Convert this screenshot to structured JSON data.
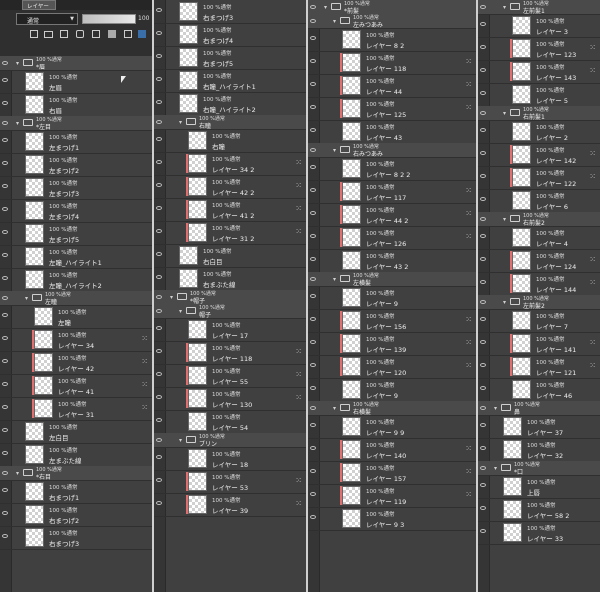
{
  "toolbar": {
    "tab_label": "レイヤー",
    "blend_mode": "通常",
    "opacity": "100",
    "icons": [
      "new-layer-icon",
      "new-folder-icon",
      "copy-layer-icon",
      "clip-icon",
      "lock-icon",
      "mask-icon",
      "delete-layer-icon"
    ]
  },
  "columns": [
    {
      "rows": [
        {
          "kind": "folder",
          "d": 0,
          "blend": "100 %通常",
          "name": "*眉"
        },
        {
          "kind": "layer",
          "d": 1,
          "blend": "100 %通常",
          "name": "左眉"
        },
        {
          "kind": "layer",
          "d": 1,
          "blend": "100 %通常",
          "name": "右眉"
        },
        {
          "kind": "folder",
          "d": 0,
          "blend": "100 %通常",
          "name": "*左目"
        },
        {
          "kind": "layer",
          "d": 1,
          "blend": "100 %通常",
          "name": "左まつげ1"
        },
        {
          "kind": "layer",
          "d": 1,
          "blend": "100 %通常",
          "name": "左まつげ2"
        },
        {
          "kind": "layer",
          "d": 1,
          "blend": "100 %通常",
          "name": "左まつげ3"
        },
        {
          "kind": "layer",
          "d": 1,
          "blend": "100 %通常",
          "name": "左まつげ4"
        },
        {
          "kind": "layer",
          "d": 1,
          "blend": "100 %通常",
          "name": "左まつげ5"
        },
        {
          "kind": "layer",
          "d": 1,
          "blend": "100 %通常",
          "name": "左瞳_ハイライト1"
        },
        {
          "kind": "layer",
          "d": 1,
          "blend": "100 %通常",
          "name": "左瞳_ハイライト2"
        },
        {
          "kind": "folder",
          "d": 1,
          "blend": "100 %通常",
          "name": "左瞳"
        },
        {
          "kind": "layer",
          "d": 2,
          "blend": "100 %通常",
          "name": "左瞳"
        },
        {
          "kind": "layer",
          "d": 2,
          "blend": "100 %通常",
          "name": "レイヤー 34",
          "clip": true
        },
        {
          "kind": "layer",
          "d": 2,
          "blend": "100 %通常",
          "name": "レイヤー 42",
          "clip": true
        },
        {
          "kind": "layer",
          "d": 2,
          "blend": "100 %通常",
          "name": "レイヤー 41",
          "clip": true
        },
        {
          "kind": "layer",
          "d": 2,
          "blend": "100 %通常",
          "name": "レイヤー 31",
          "clip": true
        },
        {
          "kind": "layer",
          "d": 1,
          "blend": "100 %通常",
          "name": "左白目"
        },
        {
          "kind": "layer",
          "d": 1,
          "blend": "100 %通常",
          "name": "左まぶた線"
        },
        {
          "kind": "folder",
          "d": 0,
          "blend": "100 %通常",
          "name": "*右目"
        },
        {
          "kind": "layer",
          "d": 1,
          "blend": "100 %通常",
          "name": "右まつげ1"
        },
        {
          "kind": "layer",
          "d": 1,
          "blend": "100 %通常",
          "name": "右まつげ2"
        },
        {
          "kind": "layer",
          "d": 1,
          "blend": "100 %通常",
          "name": "右まつげ3"
        }
      ]
    },
    {
      "rows": [
        {
          "kind": "layer",
          "d": 1,
          "blend": "100 %通常",
          "name": "右まつげ3"
        },
        {
          "kind": "layer",
          "d": 1,
          "blend": "100 %通常",
          "name": "右まつげ4"
        },
        {
          "kind": "layer",
          "d": 1,
          "blend": "100 %通常",
          "name": "右まつげ5"
        },
        {
          "kind": "layer",
          "d": 1,
          "blend": "100 %通常",
          "name": "右瞳_ハイライト1"
        },
        {
          "kind": "layer",
          "d": 1,
          "blend": "100 %通常",
          "name": "右瞳_ハイライト2"
        },
        {
          "kind": "folder",
          "d": 1,
          "blend": "100 %通常",
          "name": "右瞳"
        },
        {
          "kind": "layer",
          "d": 2,
          "blend": "100 %通常",
          "name": "右瞳"
        },
        {
          "kind": "layer",
          "d": 2,
          "blend": "100 %通常",
          "name": "レイヤー 34 2",
          "clip": true
        },
        {
          "kind": "layer",
          "d": 2,
          "blend": "100 %通常",
          "name": "レイヤー 42 2",
          "clip": true
        },
        {
          "kind": "layer",
          "d": 2,
          "blend": "100 %通常",
          "name": "レイヤー 41 2",
          "clip": true
        },
        {
          "kind": "layer",
          "d": 2,
          "blend": "100 %通常",
          "name": "レイヤー 31 2",
          "clip": true
        },
        {
          "kind": "layer",
          "d": 1,
          "blend": "100 %通常",
          "name": "右白目"
        },
        {
          "kind": "layer",
          "d": 1,
          "blend": "100 %通常",
          "name": "右まぶた線"
        },
        {
          "kind": "folder",
          "d": 0,
          "blend": "100 %通常",
          "name": "*帽子"
        },
        {
          "kind": "folder",
          "d": 1,
          "blend": "100 %通常",
          "name": "帽子"
        },
        {
          "kind": "layer",
          "d": 2,
          "blend": "100 %通常",
          "name": "レイヤー 17"
        },
        {
          "kind": "layer",
          "d": 2,
          "blend": "100 %通常",
          "name": "レイヤー 118",
          "clip": true
        },
        {
          "kind": "layer",
          "d": 2,
          "blend": "100 %通常",
          "name": "レイヤー 55",
          "clip": true
        },
        {
          "kind": "layer",
          "d": 2,
          "blend": "100 %通常",
          "name": "レイヤー 130",
          "clip": true
        },
        {
          "kind": "layer",
          "d": 2,
          "blend": "100 %通常",
          "name": "レイヤー 54"
        },
        {
          "kind": "folder",
          "d": 1,
          "blend": "100 %通常",
          "name": "ブリン"
        },
        {
          "kind": "layer",
          "d": 2,
          "blend": "100 %通常",
          "name": "レイヤー 18"
        },
        {
          "kind": "layer",
          "d": 2,
          "blend": "100 %通常",
          "name": "レイヤー 53",
          "clip": true
        },
        {
          "kind": "layer",
          "d": 2,
          "blend": "100 %通常",
          "name": "レイヤー 39",
          "clip": true
        }
      ]
    },
    {
      "rows": [
        {
          "kind": "folder",
          "d": 0,
          "blend": "100 %通常",
          "name": "*前髪"
        },
        {
          "kind": "folder",
          "d": 1,
          "blend": "100 %通常",
          "name": "左みつあみ"
        },
        {
          "kind": "layer",
          "d": 2,
          "blend": "100 %通常",
          "name": "レイヤー 8 2"
        },
        {
          "kind": "layer",
          "d": 2,
          "blend": "100 %通常",
          "name": "レイヤー 118",
          "clip": true
        },
        {
          "kind": "layer",
          "d": 2,
          "blend": "100 %通常",
          "name": "レイヤー 44",
          "clip": true
        },
        {
          "kind": "layer",
          "d": 2,
          "blend": "100 %通常",
          "name": "レイヤー 125",
          "clip": true
        },
        {
          "kind": "layer",
          "d": 2,
          "blend": "100 %通常",
          "name": "レイヤー 43"
        },
        {
          "kind": "folder",
          "d": 1,
          "blend": "100 %通常",
          "name": "右みつあみ"
        },
        {
          "kind": "layer",
          "d": 2,
          "blend": "100 %通常",
          "name": "レイヤー 8 2 2"
        },
        {
          "kind": "layer",
          "d": 2,
          "blend": "100 %通常",
          "name": "レイヤー 117",
          "clip": true
        },
        {
          "kind": "layer",
          "d": 2,
          "blend": "100 %通常",
          "name": "レイヤー 44 2",
          "clip": true
        },
        {
          "kind": "layer",
          "d": 2,
          "blend": "100 %通常",
          "name": "レイヤー 126",
          "clip": true
        },
        {
          "kind": "layer",
          "d": 2,
          "blend": "100 %通常",
          "name": "レイヤー 43 2"
        },
        {
          "kind": "folder",
          "d": 1,
          "blend": "100 %通常",
          "name": "左横髪"
        },
        {
          "kind": "layer",
          "d": 2,
          "blend": "100 %通常",
          "name": "レイヤー 9"
        },
        {
          "kind": "layer",
          "d": 2,
          "blend": "100 %通常",
          "name": "レイヤー 156",
          "clip": true
        },
        {
          "kind": "layer",
          "d": 2,
          "blend": "100 %通常",
          "name": "レイヤー 139",
          "clip": true
        },
        {
          "kind": "layer",
          "d": 2,
          "blend": "100 %通常",
          "name": "レイヤー 120",
          "clip": true
        },
        {
          "kind": "layer",
          "d": 2,
          "blend": "100 %通常",
          "name": "レイヤー 9"
        },
        {
          "kind": "folder",
          "d": 1,
          "blend": "100 %通常",
          "name": "右横髪"
        },
        {
          "kind": "layer",
          "d": 2,
          "blend": "100 %通常",
          "name": "レイヤー 9 9"
        },
        {
          "kind": "layer",
          "d": 2,
          "blend": "100 %通常",
          "name": "レイヤー 140",
          "clip": true
        },
        {
          "kind": "layer",
          "d": 2,
          "blend": "100 %通常",
          "name": "レイヤー 157",
          "clip": true
        },
        {
          "kind": "layer",
          "d": 2,
          "blend": "100 %通常",
          "name": "レイヤー 119",
          "clip": true
        },
        {
          "kind": "layer",
          "d": 2,
          "blend": "100 %通常",
          "name": "レイヤー 9 3"
        }
      ]
    },
    {
      "rows": [
        {
          "kind": "folder",
          "d": 1,
          "blend": "100 %通常",
          "name": "左前髪1"
        },
        {
          "kind": "layer",
          "d": 2,
          "blend": "100 %通常",
          "name": "レイヤー 3"
        },
        {
          "kind": "layer",
          "d": 2,
          "blend": "100 %通常",
          "name": "レイヤー 123",
          "clip": true
        },
        {
          "kind": "layer",
          "d": 2,
          "blend": "100 %通常",
          "name": "レイヤー 143",
          "clip": true
        },
        {
          "kind": "layer",
          "d": 2,
          "blend": "100 %通常",
          "name": "レイヤー 5"
        },
        {
          "kind": "folder",
          "d": 1,
          "blend": "100 %通常",
          "name": "右前髪1"
        },
        {
          "kind": "layer",
          "d": 2,
          "blend": "100 %通常",
          "name": "レイヤー 2"
        },
        {
          "kind": "layer",
          "d": 2,
          "blend": "100 %通常",
          "name": "レイヤー 142",
          "clip": true
        },
        {
          "kind": "layer",
          "d": 2,
          "blend": "100 %通常",
          "name": "レイヤー 122",
          "clip": true
        },
        {
          "kind": "layer",
          "d": 2,
          "blend": "100 %通常",
          "name": "レイヤー 6"
        },
        {
          "kind": "folder",
          "d": 1,
          "blend": "100 %通常",
          "name": "右前髪2"
        },
        {
          "kind": "layer",
          "d": 2,
          "blend": "100 %通常",
          "name": "レイヤー 4"
        },
        {
          "kind": "layer",
          "d": 2,
          "blend": "100 %通常",
          "name": "レイヤー 124",
          "clip": true
        },
        {
          "kind": "layer",
          "d": 2,
          "blend": "100 %通常",
          "name": "レイヤー 144",
          "clip": true
        },
        {
          "kind": "folder",
          "d": 1,
          "blend": "100 %通常",
          "name": "左前髪2"
        },
        {
          "kind": "layer",
          "d": 2,
          "blend": "100 %通常",
          "name": "レイヤー 7"
        },
        {
          "kind": "layer",
          "d": 2,
          "blend": "100 %通常",
          "name": "レイヤー 141",
          "clip": true
        },
        {
          "kind": "layer",
          "d": 2,
          "blend": "100 %通常",
          "name": "レイヤー 121",
          "clip": true
        },
        {
          "kind": "layer",
          "d": 2,
          "blend": "100 %通常",
          "name": "レイヤー 46"
        },
        {
          "kind": "folder",
          "d": 0,
          "blend": "100 %通常",
          "name": "鼻"
        },
        {
          "kind": "layer",
          "d": 1,
          "blend": "100 %通常",
          "name": "レイヤー 37"
        },
        {
          "kind": "layer",
          "d": 1,
          "blend": "100 %通常",
          "name": "レイヤー 32"
        },
        {
          "kind": "folder",
          "d": 0,
          "blend": "100 %通常",
          "name": "*口"
        },
        {
          "kind": "layer",
          "d": 1,
          "blend": "100 %通常",
          "name": "上唇"
        },
        {
          "kind": "layer",
          "d": 1,
          "blend": "100 %通常",
          "name": "レイヤー 58 2"
        },
        {
          "kind": "layer",
          "d": 1,
          "blend": "100 %通常",
          "name": "レイヤー 33"
        }
      ]
    }
  ]
}
